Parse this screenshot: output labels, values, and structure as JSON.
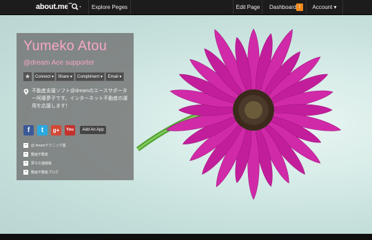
{
  "topbar": {
    "logo": "about.me",
    "logo_tm": "™",
    "search_icon": "search-icon",
    "explore": "Explore Peges",
    "edit_page": "Edit Page",
    "dashboard": "Dashboard",
    "dashboard_badge": "!",
    "account": "Account ▾"
  },
  "profile": {
    "name": "Yumeko Atou",
    "tagline": "@dream Ace supporter",
    "buttons": [
      "Connect ▾",
      "Share ▾",
      "Compliment ▾",
      "Email ▾"
    ],
    "bio": "不動産支援ソフト@dreamのエースサポーター阿藤夢子です。インターネット不動産の運用を応援します！",
    "social": [
      {
        "icon": "facebook-icon",
        "label": "f",
        "color": "#3b5998"
      },
      {
        "icon": "twitter-icon",
        "label": "t",
        "color": "#2aa9e0"
      },
      {
        "icon": "google-plus-icon",
        "label": "g+",
        "color": "#d34836"
      },
      {
        "icon": "youtube-icon",
        "label": "You",
        "color": "#c4302b"
      }
    ],
    "add_app": "Add An App",
    "links": [
      {
        "icon": "blog-icon",
        "text": "@ dreamテクニック集"
      },
      {
        "icon": "blog-icon",
        "text": "動画不動産"
      },
      {
        "icon": "blog-icon",
        "text": "夢子の連絡帳"
      },
      {
        "icon": "blog-icon",
        "text": "動画不動産ブログ"
      }
    ]
  },
  "colors": {
    "accent": "#f7a6c8",
    "badge": "#f08a1c"
  }
}
